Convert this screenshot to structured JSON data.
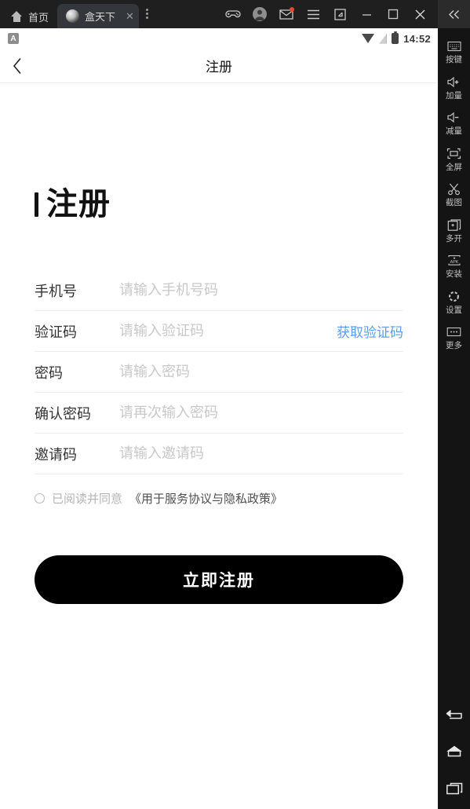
{
  "titlebar": {
    "tabs": [
      {
        "label": "首页",
        "icon": "home-icon",
        "active": false,
        "closable": false
      },
      {
        "label": "盒天下",
        "icon": "app-favicon",
        "active": true,
        "closable": true,
        "close_label": "✕"
      }
    ],
    "tab_overflow_icon": "kebab-menu-icon",
    "window_tools": [
      {
        "name": "gamepad-icon"
      },
      {
        "name": "user-avatar-icon"
      },
      {
        "name": "mail-icon",
        "badge": true
      },
      {
        "name": "hamburger-menu-icon"
      },
      {
        "name": "resize-icon"
      },
      {
        "name": "minimize-icon"
      },
      {
        "name": "maximize-icon"
      },
      {
        "name": "close-icon"
      }
    ],
    "collapse_icon": "chevron-double-left-icon"
  },
  "statusbar": {
    "left_badge": "A",
    "icons": [
      "wifi-icon",
      "signal-icon",
      "battery-icon"
    ],
    "time": "14:52"
  },
  "appbar": {
    "back_icon": "chevron-left-icon",
    "title": "注册"
  },
  "page": {
    "heading": "注册",
    "fields": [
      {
        "label": "手机号",
        "placeholder": "请输入手机号码",
        "value": "",
        "action": null
      },
      {
        "label": "验证码",
        "placeholder": "请输入验证码",
        "value": "",
        "action": "获取验证码"
      },
      {
        "label": "密码",
        "placeholder": "请输入密码",
        "value": "",
        "action": null
      },
      {
        "label": "确认密码",
        "placeholder": "请再次输入密码",
        "value": "",
        "action": null
      },
      {
        "label": "邀请码",
        "placeholder": "请输入邀请码",
        "value": "",
        "action": null
      }
    ],
    "agreement": {
      "checked": false,
      "text": "已阅读并同意",
      "link": "《用于服务协议与隐私政策》"
    },
    "submit_label": "立即注册"
  },
  "sidebar": {
    "items": [
      {
        "label": "按键",
        "icon": "keyboard-icon"
      },
      {
        "label": "加量",
        "icon": "volume-up-icon"
      },
      {
        "label": "减量",
        "icon": "volume-down-icon"
      },
      {
        "label": "全屏",
        "icon": "fullscreen-icon"
      },
      {
        "label": "截图",
        "icon": "scissors-icon"
      },
      {
        "label": "多开",
        "icon": "multi-instance-icon"
      },
      {
        "label": "安装",
        "icon": "apk-install-icon"
      },
      {
        "label": "设置",
        "icon": "gear-icon"
      },
      {
        "label": "更多",
        "icon": "ellipsis-icon"
      }
    ],
    "nav": [
      {
        "icon": "nav-back-icon"
      },
      {
        "icon": "nav-home-icon"
      },
      {
        "icon": "nav-recents-icon"
      }
    ]
  },
  "colors": {
    "accent_link": "#5d9ce8",
    "button_bg": "#000000",
    "sidebar_bg": "#141414",
    "titlebar_bg": "#1f1f1f",
    "badge_red": "#e8452c"
  }
}
